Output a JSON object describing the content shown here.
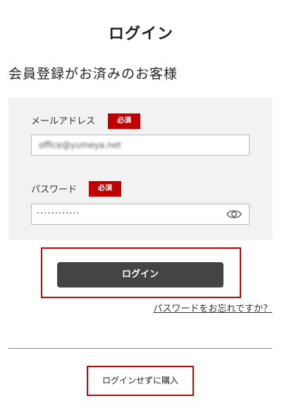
{
  "page_title": "ログイン",
  "section_title": "会員登録がお済みのお客様",
  "form": {
    "email": {
      "label": "メールアドレス",
      "required_label": "必須",
      "value": "office@yumeya.net"
    },
    "password": {
      "label": "パスワード",
      "required_label": "必須",
      "value": "············",
      "toggle_icon": "eye-icon"
    }
  },
  "login_button_label": "ログイン",
  "forgot_password_link": "パスワードをお忘れですか？",
  "guest_purchase_link": "ログインせずに購入",
  "colors": {
    "accent_red": "#c00000",
    "highlight_red": "#d00000",
    "button_dark": "#444444",
    "panel_bg": "#f2f2f2"
  }
}
